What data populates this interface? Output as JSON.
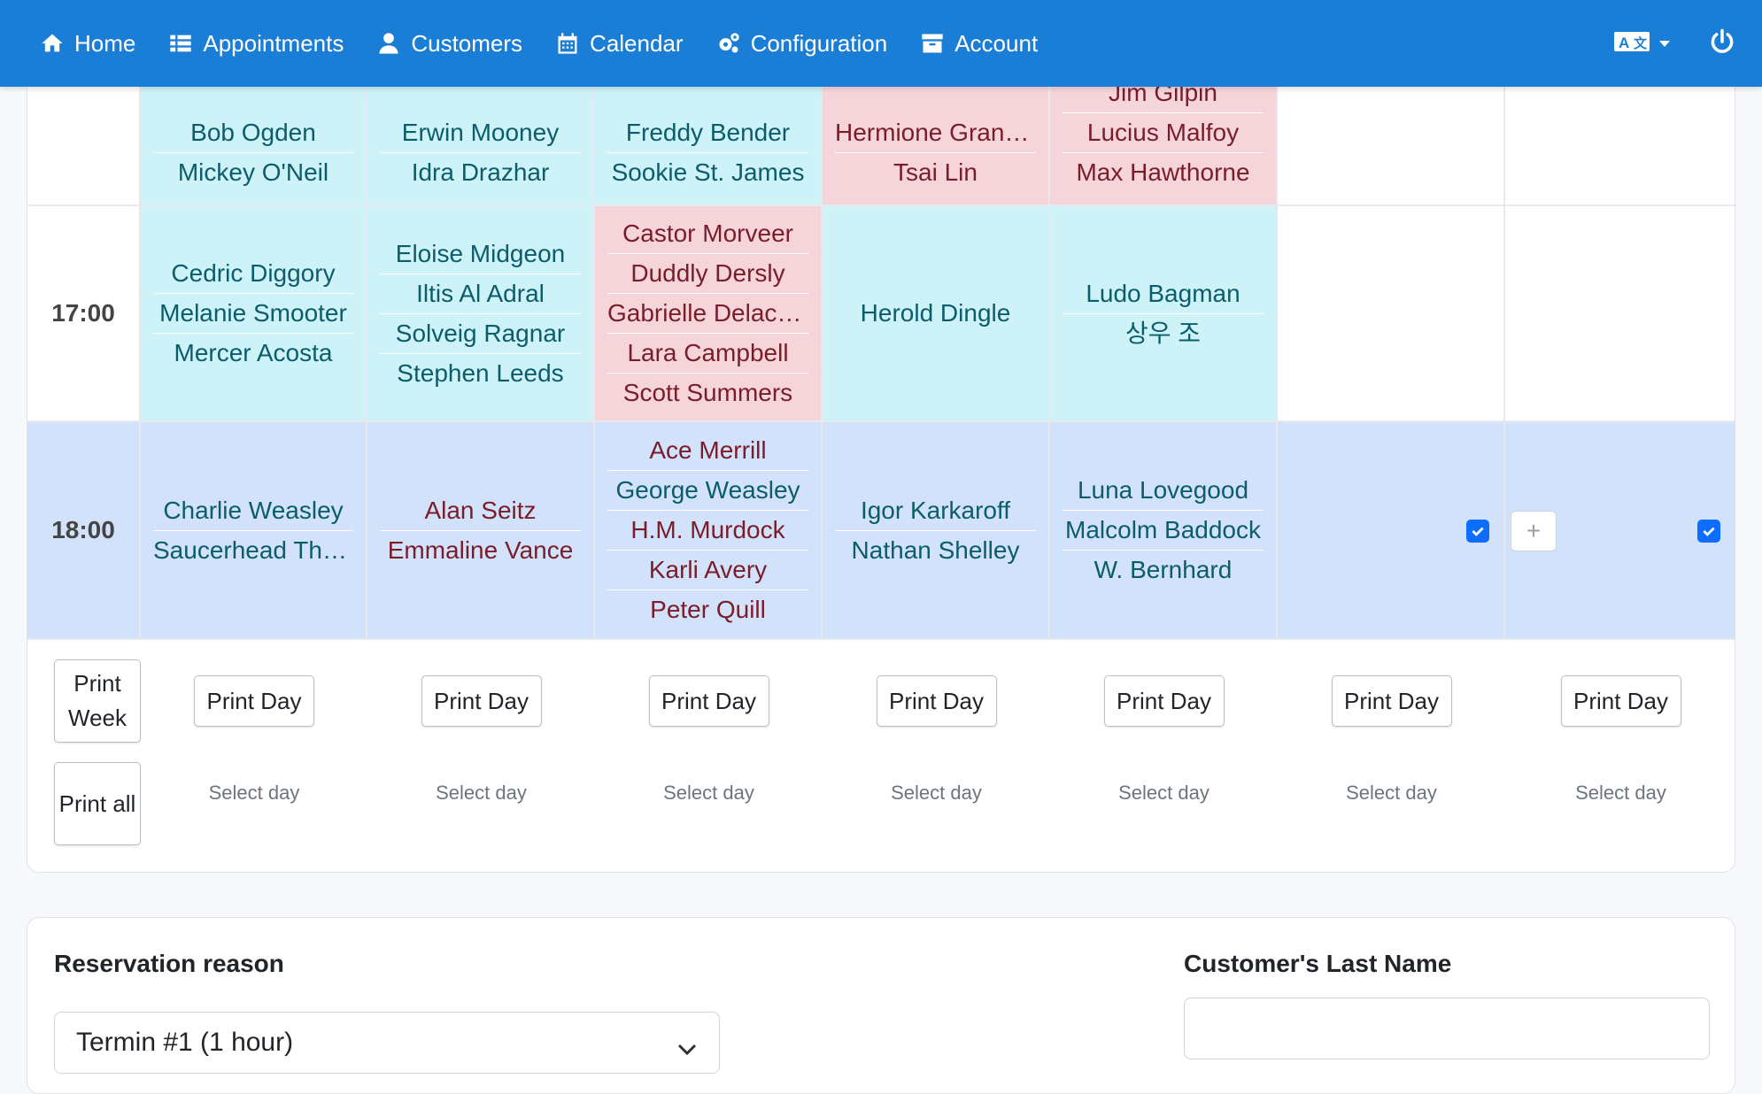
{
  "nav": {
    "items": [
      {
        "label": "Home",
        "icon": "home-icon"
      },
      {
        "label": "Appointments",
        "icon": "list-icon"
      },
      {
        "label": "Customers",
        "icon": "user-icon"
      },
      {
        "label": "Calendar",
        "icon": "calendar-icon"
      },
      {
        "label": "Configuration",
        "icon": "gears-icon"
      },
      {
        "label": "Account",
        "icon": "archive-icon"
      }
    ],
    "language_icon": "translate-icon",
    "logout_icon": "power-icon",
    "color": "#1b7ed6"
  },
  "schedule": {
    "rows": [
      {
        "time": "",
        "slots": [
          {
            "color": "cyan",
            "names": [
              "Bob Ogden",
              "Mickey O'Neil"
            ]
          },
          {
            "color": "cyan",
            "names": [
              "Erwin Mooney",
              "Idra Drazhar"
            ]
          },
          {
            "color": "cyan",
            "names": [
              "Freddy Bender",
              "Sookie St. James"
            ]
          },
          {
            "color": "pink",
            "names": [
              "Hermione Granger",
              "Tsai Lin"
            ]
          },
          {
            "color": "pink",
            "names": [
              "Jim Gilpin",
              "Lucius Malfoy",
              "Max Hawthorne"
            ]
          },
          {
            "color": "white",
            "names": []
          },
          {
            "color": "white",
            "names": []
          }
        ]
      },
      {
        "time": "17:00",
        "slots": [
          {
            "color": "cyan",
            "names": [
              "Cedric Diggory",
              "Melanie Smooter",
              "Mercer Acosta"
            ]
          },
          {
            "color": "cyan",
            "names": [
              "Eloise Midgeon",
              "Iltis Al Adral",
              "Solveig Ragnar",
              "Stephen Leeds"
            ]
          },
          {
            "color": "pink",
            "names": [
              "Castor Morveer",
              "Duddly Dersly",
              "Gabrielle Delacour",
              "Lara Campbell",
              "Scott Summers"
            ]
          },
          {
            "color": "cyan",
            "names": [
              "Herold Dingle"
            ]
          },
          {
            "color": "cyan",
            "names": [
              "Ludo Bagman",
              "상우 조"
            ]
          },
          {
            "color": "white",
            "names": []
          },
          {
            "color": "white",
            "names": []
          }
        ]
      },
      {
        "time": "18:00",
        "slots": [
          {
            "color": "blue",
            "names": [
              {
                "n": "Charlie Weasley",
                "c": "green"
              },
              {
                "n": "Saucerhead Tharpe",
                "c": "green"
              }
            ]
          },
          {
            "color": "blue",
            "names": [
              {
                "n": "Alan Seitz",
                "c": "red"
              },
              {
                "n": "Emmaline Vance",
                "c": "red"
              }
            ]
          },
          {
            "color": "blue",
            "names": [
              {
                "n": "Ace Merrill",
                "c": "red"
              },
              {
                "n": "George Weasley",
                "c": "green"
              },
              {
                "n": "H.M. Murdock",
                "c": "red"
              },
              {
                "n": "Karli Avery",
                "c": "red"
              },
              {
                "n": "Peter Quill",
                "c": "red"
              }
            ]
          },
          {
            "color": "blue",
            "names": [
              {
                "n": "Igor Karkaroff",
                "c": "green"
              },
              {
                "n": "Nathan Shelley",
                "c": "green"
              }
            ]
          },
          {
            "color": "blue",
            "names": [
              {
                "n": "Luna Lovegood",
                "c": "green"
              },
              {
                "n": "Malcolm Baddock",
                "c": "green"
              },
              {
                "n": "W. Bernhard",
                "c": "green"
              }
            ]
          },
          {
            "color": "blue",
            "names": []
          },
          {
            "color": "blue",
            "names": []
          }
        ]
      }
    ],
    "print_week_label": "Print Week",
    "print_all_label": "Print all",
    "print_day_label": "Print Day",
    "select_day_label": "Select day",
    "add_button_label": "+",
    "colors": {
      "cyan": "#cdf2f8",
      "pink": "#f6d5da",
      "blue": "#d2e2fb",
      "name_green": "#0c5d6c",
      "name_red": "#7a1d2b",
      "checkbox": "#0d6efd"
    }
  },
  "form": {
    "reason_label": "Reservation reason",
    "reason_value": "Termin #1 (1 hour)",
    "last_name_label": "Customer's Last Name",
    "last_name_value": ""
  }
}
